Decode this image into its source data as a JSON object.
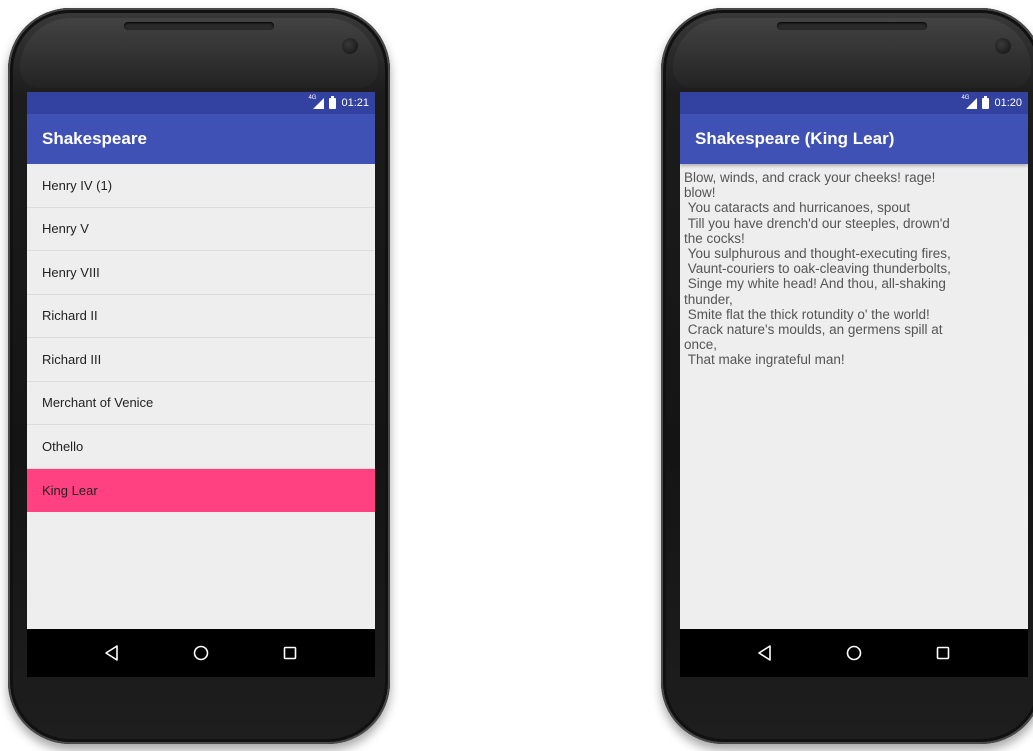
{
  "left_phone": {
    "status": {
      "time": "01:21",
      "network": "4G"
    },
    "appbar": {
      "title": "Shakespeare"
    },
    "list": [
      {
        "label": "Henry IV (1)"
      },
      {
        "label": "Henry V"
      },
      {
        "label": "Henry VIII"
      },
      {
        "label": "Richard II"
      },
      {
        "label": "Richard III"
      },
      {
        "label": "Merchant of Venice"
      },
      {
        "label": "Othello"
      },
      {
        "label": "King Lear"
      }
    ],
    "selected_index": 7
  },
  "right_phone": {
    "status": {
      "time": "01:20",
      "network": "4G"
    },
    "appbar": {
      "title": "Shakespeare (King Lear)"
    },
    "detail_text": "Blow, winds, and crack your cheeks! rage!\nblow!\n You cataracts and hurricanoes, spout\n Till you have drench'd our steeples, drown'd\nthe cocks!\n You sulphurous and thought-executing fires,\n Vaunt-couriers to oak-cleaving thunderbolts,\n Singe my white head! And thou, all-shaking\nthunder,\n Smite flat the thick rotundity o' the world!\n Crack nature's moulds, an germens spill at\nonce,\n That make ingrateful man!"
  },
  "colors": {
    "statusbar": "#3341a0",
    "appbar": "#3f51b5",
    "accent": "#ff4081",
    "background": "#eeeeee",
    "navbar": "#000000"
  },
  "nav_icons": [
    "back-icon",
    "home-icon",
    "recents-icon"
  ]
}
